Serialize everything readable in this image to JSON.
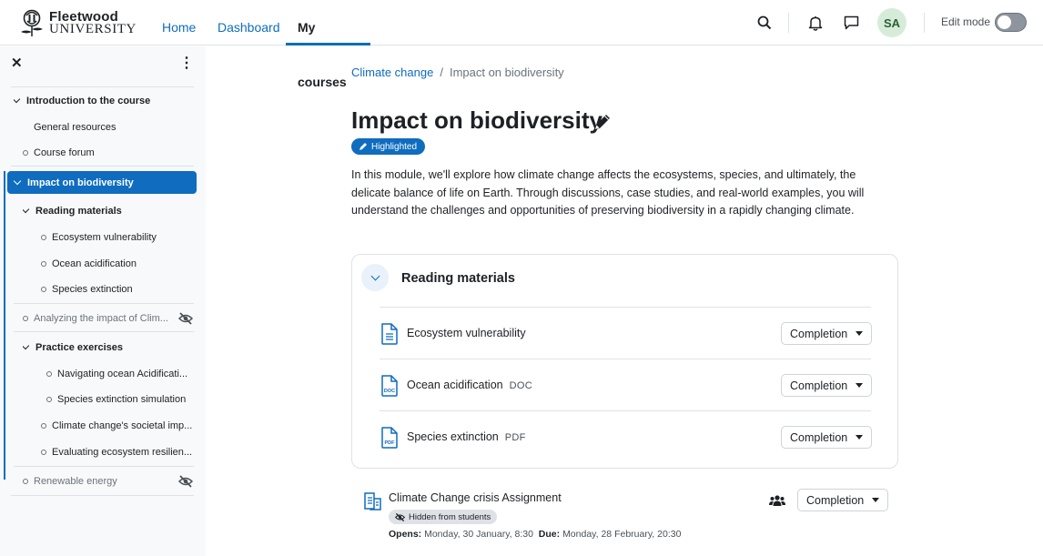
{
  "brand": {
    "name_top": "Fleetwood",
    "name_bottom": "UNIVERSITY"
  },
  "nav": {
    "home": "Home",
    "dashboard": "Dashboard",
    "my_courses": "My courses"
  },
  "user": {
    "initials": "SA"
  },
  "edit_mode": {
    "label": "Edit mode",
    "enabled": false
  },
  "sidebar": {
    "close": "✕",
    "more": "⋮",
    "items": [
      {
        "label": "Introduction to the course"
      },
      {
        "label": "General resources"
      },
      {
        "label": "Course forum"
      },
      {
        "label": "Impact on biodiversity"
      },
      {
        "label": "Reading materials"
      },
      {
        "label": "Ecosystem vulnerability"
      },
      {
        "label": "Ocean acidification"
      },
      {
        "label": "Species extinction"
      },
      {
        "label": "Analyzing the impact of Clim..."
      },
      {
        "label": "Practice exercises"
      },
      {
        "label": "Navigating ocean Acidificati..."
      },
      {
        "label": "Species extinction simulation"
      },
      {
        "label": "Climate change's societal imp..."
      },
      {
        "label": "Evaluating ecosystem resilien..."
      },
      {
        "label": "Renewable energy"
      }
    ]
  },
  "breadcrumb": {
    "course": "Climate change",
    "separator": "/",
    "current": "Impact on biodiversity"
  },
  "page": {
    "title": "Impact on biodiversity",
    "badge": "Highlighted",
    "description": "In this module, we'll explore how climate change affects the ecosystems, species, and ultimately, the delicate balance of life on Earth. Through discussions, case studies, and real-world examples, you will understand the challenges and opportunities of preserving biodiversity in a rapidly changing climate."
  },
  "section": {
    "title": "Reading materials",
    "activities": [
      {
        "name": "Ecosystem vulnerability",
        "type": "",
        "completion": "Completion"
      },
      {
        "name": "Ocean acidification",
        "type": "DOC",
        "completion": "Completion"
      },
      {
        "name": "Species extinction",
        "type": "PDF",
        "completion": "Completion"
      }
    ]
  },
  "assignment": {
    "title": "Climate Change crisis Assignment",
    "hidden_label": "Hidden from students",
    "opens_label": "Opens:",
    "opens": "Monday, 30 January, 8:30",
    "due_label": "Due:",
    "due": "Monday, 28 February, 20:30",
    "completion": "Completion"
  },
  "colors": {
    "primary": "#0f6cbf",
    "avatar_bg": "#d6ecd9",
    "sidebar_bg": "#f8f9fa"
  }
}
